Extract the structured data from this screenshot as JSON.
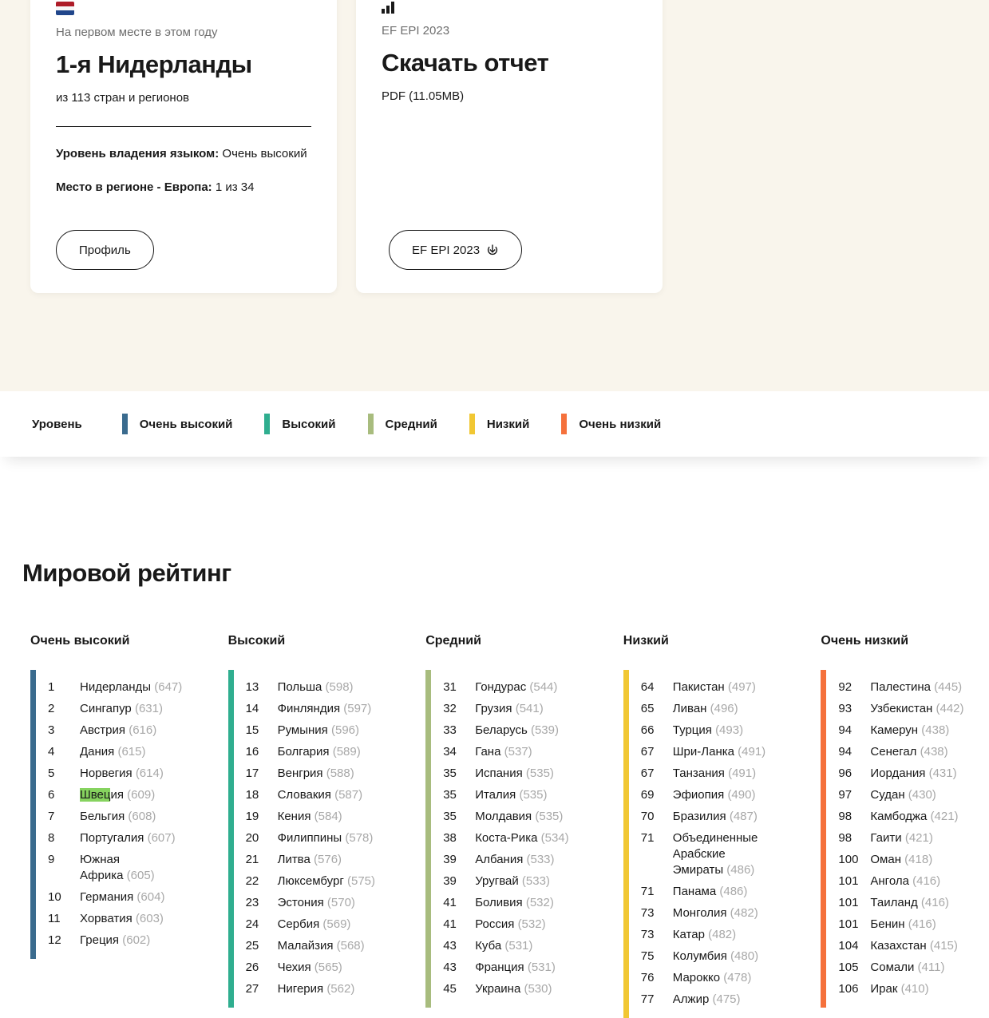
{
  "top_cards": {
    "rank_card": {
      "flag_icon": "netherlands-flag",
      "eyebrow": "На первом месте в этом году",
      "title": "1-я Нидерланды",
      "subtitle": "из 113 стран и регионов",
      "proficiency_label": "Уровень владения языком:",
      "proficiency_value": "Очень высокий",
      "region_label": "Место в регионе - Европа:",
      "region_value": "1 из 34",
      "button_label": "Профиль"
    },
    "download_card": {
      "icon": "bar-chart",
      "eyebrow": "EF EPI 2023",
      "title": "Скачать отчет",
      "subtitle": "PDF (11.05MB)",
      "button_label": "EF EPI 2023",
      "button_icon": "download"
    }
  },
  "legend": {
    "label": "Уровень",
    "items": [
      {
        "label": "Очень высокий",
        "color": "#3a6b8e"
      },
      {
        "label": "Высокий",
        "color": "#2fae8f"
      },
      {
        "label": "Средний",
        "color": "#a8bc7e"
      },
      {
        "label": "Низкий",
        "color": "#f1c733"
      },
      {
        "label": "Очень низкий",
        "color": "#f5713c"
      }
    ]
  },
  "ranking": {
    "title": "Мировой рейтинг",
    "highlight_color": "#86d35f",
    "columns": [
      {
        "header": "Очень высокий",
        "color": "#3a6b8e",
        "rows": [
          {
            "rank": "1",
            "country": "Нидерланды",
            "score": "647"
          },
          {
            "rank": "2",
            "country": "Сингапур",
            "score": "631"
          },
          {
            "rank": "3",
            "country": "Австрия",
            "score": "616"
          },
          {
            "rank": "4",
            "country": "Дания",
            "score": "615"
          },
          {
            "rank": "5",
            "country": "Норвегия",
            "score": "614"
          },
          {
            "rank": "6",
            "country": "Швеция",
            "score": "609",
            "highlight": "Швец"
          },
          {
            "rank": "7",
            "country": "Бельгия",
            "score": "608"
          },
          {
            "rank": "8",
            "country": "Португалия",
            "score": "607"
          },
          {
            "rank": "9",
            "country": "Южная Африка",
            "score": "605"
          },
          {
            "rank": "10",
            "country": "Германия",
            "score": "604"
          },
          {
            "rank": "11",
            "country": "Хорватия",
            "score": "603"
          },
          {
            "rank": "12",
            "country": "Греция",
            "score": "602"
          }
        ]
      },
      {
        "header": "Высокий",
        "color": "#2fae8f",
        "rows": [
          {
            "rank": "13",
            "country": "Польша",
            "score": "598"
          },
          {
            "rank": "14",
            "country": "Финляндия",
            "score": "597"
          },
          {
            "rank": "15",
            "country": "Румыния",
            "score": "596"
          },
          {
            "rank": "16",
            "country": "Болгария",
            "score": "589"
          },
          {
            "rank": "17",
            "country": "Венгрия",
            "score": "588"
          },
          {
            "rank": "18",
            "country": "Словакия",
            "score": "587"
          },
          {
            "rank": "19",
            "country": "Кения",
            "score": "584"
          },
          {
            "rank": "20",
            "country": "Филиппины",
            "score": "578"
          },
          {
            "rank": "21",
            "country": "Литва",
            "score": "576"
          },
          {
            "rank": "22",
            "country": "Люксембург",
            "score": "575"
          },
          {
            "rank": "23",
            "country": "Эстония",
            "score": "570"
          },
          {
            "rank": "24",
            "country": "Сербия",
            "score": "569"
          },
          {
            "rank": "25",
            "country": "Малайзия",
            "score": "568"
          },
          {
            "rank": "26",
            "country": "Чехия",
            "score": "565"
          },
          {
            "rank": "27",
            "country": "Нигерия",
            "score": "562"
          }
        ]
      },
      {
        "header": "Средний",
        "color": "#a8bc7e",
        "rows": [
          {
            "rank": "31",
            "country": "Гондурас",
            "score": "544"
          },
          {
            "rank": "32",
            "country": "Грузия",
            "score": "541"
          },
          {
            "rank": "33",
            "country": "Беларусь",
            "score": "539"
          },
          {
            "rank": "34",
            "country": "Гана",
            "score": "537"
          },
          {
            "rank": "35",
            "country": "Испания",
            "score": "535"
          },
          {
            "rank": "35",
            "country": "Италия",
            "score": "535"
          },
          {
            "rank": "35",
            "country": "Молдавия",
            "score": "535"
          },
          {
            "rank": "38",
            "country": "Коста-Рика",
            "score": "534"
          },
          {
            "rank": "39",
            "country": "Албания",
            "score": "533"
          },
          {
            "rank": "39",
            "country": "Уругвай",
            "score": "533"
          },
          {
            "rank": "41",
            "country": "Боливия",
            "score": "532"
          },
          {
            "rank": "41",
            "country": "Россия",
            "score": "532"
          },
          {
            "rank": "43",
            "country": "Куба",
            "score": "531"
          },
          {
            "rank": "43",
            "country": "Франция",
            "score": "531"
          },
          {
            "rank": "45",
            "country": "Украина",
            "score": "530"
          }
        ]
      },
      {
        "header": "Низкий",
        "color": "#f1c733",
        "rows": [
          {
            "rank": "64",
            "country": "Пакистан",
            "score": "497"
          },
          {
            "rank": "65",
            "country": "Ливан",
            "score": "496"
          },
          {
            "rank": "66",
            "country": "Турция",
            "score": "493"
          },
          {
            "rank": "67",
            "country": "Шри-Ланка",
            "score": "491"
          },
          {
            "rank": "67",
            "country": "Танзания",
            "score": "491"
          },
          {
            "rank": "69",
            "country": "Эфиопия",
            "score": "490"
          },
          {
            "rank": "70",
            "country": "Бразилия",
            "score": "487"
          },
          {
            "rank": "71",
            "country": "Объединенные Арабские Эмираты",
            "score": "486"
          },
          {
            "rank": "71",
            "country": "Панама",
            "score": "486"
          },
          {
            "rank": "73",
            "country": "Монголия",
            "score": "482"
          },
          {
            "rank": "73",
            "country": "Катар",
            "score": "482"
          },
          {
            "rank": "75",
            "country": "Колумбия",
            "score": "480"
          },
          {
            "rank": "76",
            "country": "Марокко",
            "score": "478"
          },
          {
            "rank": "77",
            "country": "Алжир",
            "score": "475"
          }
        ]
      },
      {
        "header": "Очень низкий",
        "color": "#f5713c",
        "rows": [
          {
            "rank": "92",
            "country": "Палестина",
            "score": "445"
          },
          {
            "rank": "93",
            "country": "Узбекистан",
            "score": "442"
          },
          {
            "rank": "94",
            "country": "Камерун",
            "score": "438"
          },
          {
            "rank": "94",
            "country": "Сенегал",
            "score": "438"
          },
          {
            "rank": "96",
            "country": "Иордания",
            "score": "431"
          },
          {
            "rank": "97",
            "country": "Судан",
            "score": "430"
          },
          {
            "rank": "98",
            "country": "Камбоджа",
            "score": "421"
          },
          {
            "rank": "98",
            "country": "Гаити",
            "score": "421"
          },
          {
            "rank": "100",
            "country": "Оман",
            "score": "418"
          },
          {
            "rank": "101",
            "country": "Ангола",
            "score": "416"
          },
          {
            "rank": "101",
            "country": "Таиланд",
            "score": "416"
          },
          {
            "rank": "101",
            "country": "Бенин",
            "score": "416"
          },
          {
            "rank": "104",
            "country": "Казахстан",
            "score": "415"
          },
          {
            "rank": "105",
            "country": "Сомали",
            "score": "411"
          },
          {
            "rank": "106",
            "country": "Ирак",
            "score": "410"
          }
        ]
      }
    ]
  }
}
